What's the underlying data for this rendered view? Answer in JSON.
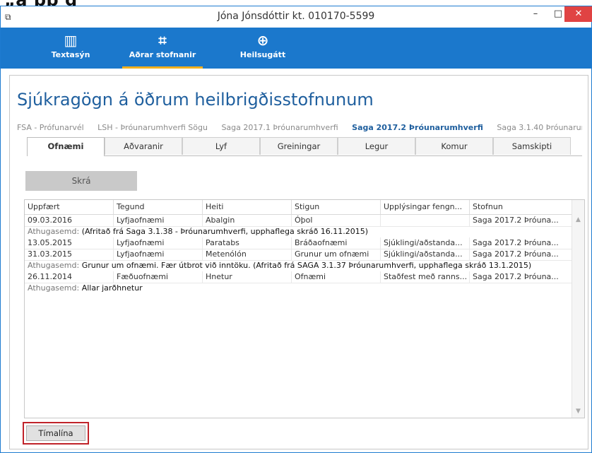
{
  "window": {
    "title": "Jóna Jónsdóttir kt. 010170-5599",
    "app_icon": "app-icon",
    "controls": {
      "minimize": "–",
      "maximize": "□",
      "close": "✕"
    }
  },
  "toolbar": {
    "items": [
      {
        "label": "Textasýn",
        "icon": "library-icon",
        "glyph": "▥"
      },
      {
        "label": "Aðrar stofnanir",
        "icon": "network-icon",
        "glyph": "⌗"
      },
      {
        "label": "Heilsugátt",
        "icon": "lifebuoy-icon",
        "glyph": "⊕"
      }
    ],
    "active_index": 1,
    "accent": "#1b78cc",
    "active_underline": "#f2b01e"
  },
  "main": {
    "heading": "Sjúkragögn á öðrum heilbrigðisstofnunum",
    "institutions": [
      "FSA - Prófunarvél",
      "LSH - Þróunarumhverfi Sögu",
      "Saga 2017.1 Þróunarumhverfi",
      "Saga 2017.2 Þróunarumhverfi",
      "Saga 3.1.40 Þróunarumhverfi"
    ],
    "active_institution": 3,
    "tabs": [
      "Ofnæmi",
      "Aðvaranir",
      "Lyf",
      "Greiningar",
      "Legur",
      "Komur",
      "Samskipti"
    ],
    "active_tab": 0,
    "register_button": "Skrá",
    "timeline_button": "Tímalína"
  },
  "table": {
    "columns": [
      "Uppfært",
      "Tegund",
      "Heiti",
      "Stigun",
      "Upplýsingar fengn...",
      "Stofnun"
    ],
    "note_label": "Athugasemd:",
    "rows": [
      {
        "date": "09.03.2016",
        "type": "Lyfjaofnæmi",
        "name": "Abalgin",
        "grade": "Óþol",
        "info": "",
        "institution": "Saga 2017.2 Þróuna...",
        "note": "(Afritað frá Saga 3.1.38 - Þróunarumhverfi, upphaflega skráð 16.11.2015)"
      },
      {
        "date": "13.05.2015",
        "type": "Lyfjaofnæmi",
        "name": "Paratabs",
        "grade": "Bráðaofnæmi",
        "info": "Sjúklingi/aðstanda...",
        "institution": "Saga 2017.2 Þróuna...",
        "note": ""
      },
      {
        "date": "31.03.2015",
        "type": "Lyfjaofnæmi",
        "name": "Metenólón",
        "grade": "Grunur um ofnæmi",
        "info": "Sjúklingi/aðstanda...",
        "institution": "Saga 2017.2 Þróuna...",
        "note": "Grunur um ofnæmi.  Fær útbrot við inntöku. (Afritað frá SAGA 3.1.37 Þróunarumhverfi, upphaflega skráð 13.1.2015)"
      },
      {
        "date": "26.11.2014",
        "type": "Fæðuofnæmi",
        "name": "Hnetur",
        "grade": "Ofnæmi",
        "info": "Staðfest með ranns...",
        "institution": "Saga 2017.2 Þróuna...",
        "note": "Allar jarðhnetur"
      }
    ]
  }
}
